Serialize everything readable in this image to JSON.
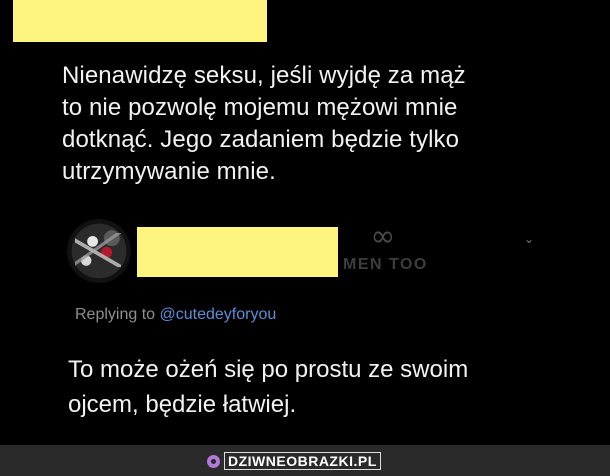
{
  "original_tweet": {
    "lines": [
      "Nienawidzę seksu, jeśli wyjdę za mąż",
      "to nie pozwolę mojemu mężowi mnie",
      "dotknąć. Jego zadaniem będzie tylko",
      "utrzymywanie mnie."
    ]
  },
  "reply": {
    "watermark": {
      "symbol": "∞",
      "label": "MEN TOO"
    },
    "chevron": "⌄",
    "replying_prefix": "Replying to ",
    "replying_handle": "@cutedeyforyou",
    "text_lines": [
      "To może ożeń się po prostu ze swoim",
      "ojcem, będzie łatwiej."
    ]
  },
  "footer": {
    "brand": "DZIWNEOBRAZKI.PL"
  },
  "colors": {
    "background": "#000000",
    "redaction": "#fef57f",
    "text": "#f2f2f2",
    "muted": "#8f8f8f",
    "link": "#5c8fd6",
    "footer_bg": "#2a2a2a",
    "brand_accent": "#b07ad6"
  }
}
